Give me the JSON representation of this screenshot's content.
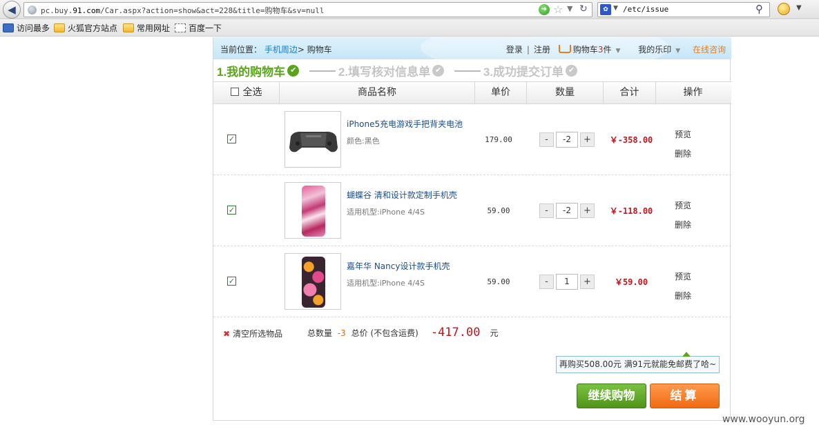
{
  "browser": {
    "back_glyph": "◀",
    "url_prefix": "pc.buy.",
    "url_host": "91.com",
    "url_rest": "/Car.aspx?action=show&act=228&title=购物车&sv=null",
    "search_value": "/etc/issue"
  },
  "bookmarks": [
    "访问最多",
    "火狐官方站点",
    "常用网址",
    "百度一下"
  ],
  "topbar": {
    "location_label": "当前位置：",
    "crumb_link": "手机周边",
    "crumb_sep": ">",
    "crumb_current": "购物车",
    "login": "登录",
    "sep": "|",
    "register": "注册",
    "cart_label": "购物车",
    "cart_count": "3",
    "cart_unit": "件",
    "my_print": "我的乐印",
    "consult": "在线咨询"
  },
  "steps": [
    {
      "label": "1.我的购物车"
    },
    {
      "label": "2.填写核对信息单"
    },
    {
      "label": "3.成功提交订单"
    }
  ],
  "table": {
    "select_all": "全选",
    "headers": [
      "商品名称",
      "单价",
      "数量",
      "合计",
      "操作"
    ]
  },
  "items": [
    {
      "name": "iPhone5充电游戏手把背夹电池",
      "attr": "颜色:黑色",
      "price": "179.00",
      "qty": "-2",
      "subtotal": "￥-358.00",
      "preview": "预览",
      "delete": "删除"
    },
    {
      "name": "蝴蝶谷 清和设计款定制手机壳",
      "attr": "适用机型:iPhone 4/4S",
      "price": "59.00",
      "qty": "-2",
      "subtotal": "￥-118.00",
      "preview": "预览",
      "delete": "删除"
    },
    {
      "name": "嘉年华 Nancy设计款手机壳",
      "attr": "适用机型:iPhone 4/4S",
      "price": "59.00",
      "qty": "1",
      "subtotal": "￥59.00",
      "preview": "预览",
      "delete": "删除"
    }
  ],
  "qty_minus": "-",
  "qty_plus": "+",
  "footer": {
    "clear_selected": "清空所选物品",
    "total_qty_label": "总数量",
    "total_qty": "-3",
    "total_price_label": "总价 (不包含运费)",
    "total_price": "-417.00",
    "currency_unit": "元",
    "tip": "再购买508.00元 满91元就能免邮费了哈~",
    "continue": "继续购物",
    "checkout": "结算"
  },
  "watermark": "www.wooyun.org",
  "colors": {
    "accent_green": "#5aa51a",
    "price_red": "#c4141c",
    "checkout_orange": "#f06a12",
    "link_blue": "#1a7cc7"
  }
}
